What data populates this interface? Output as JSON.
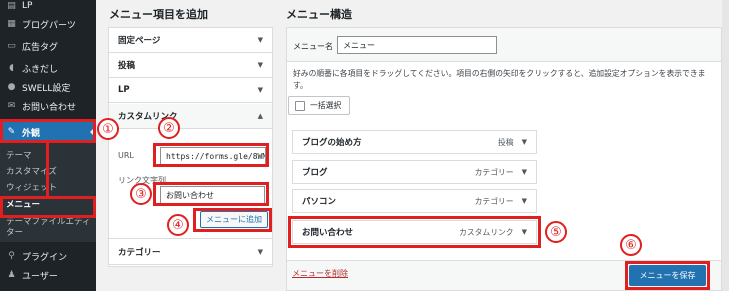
{
  "sidebar": {
    "items": [
      {
        "label": "LP",
        "icon": "page-icon"
      },
      {
        "label": "ブログパーツ",
        "icon": "parts-icon"
      },
      {
        "label": "広告タグ",
        "icon": "ad-icon"
      },
      {
        "label": "ふきだし",
        "icon": "balloon-icon"
      },
      {
        "label": "SWELL設定",
        "icon": "settings-icon"
      },
      {
        "label": "お問い合わせ",
        "icon": "mail-icon"
      },
      {
        "label": "外観",
        "icon": "brush-icon"
      }
    ],
    "submenu": [
      "テーマ",
      "カスタマイズ",
      "ウィジェット",
      "メニュー",
      "テーマファイルエディ",
      "ター"
    ],
    "bottom_items": [
      {
        "label": "プラグイン",
        "icon": "plugin-icon"
      },
      {
        "label": "ユーザー",
        "icon": "user-icon"
      }
    ]
  },
  "add_panel": {
    "title": "メニュー項目を追加",
    "sections": [
      "固定ページ",
      "投稿",
      "LP",
      "カスタムリンク",
      "カテゴリー"
    ],
    "url_label": "URL",
    "url_value": "https://forms.gle/8WM",
    "link_text_label": "リンク文字列",
    "link_text_value": "お問い合わせ",
    "add_button": "メニューに追加"
  },
  "structure": {
    "title": "メニュー構造",
    "menu_name_label": "メニュー名",
    "menu_name_value": "メニュー",
    "instructions": "好みの順番に各項目をドラッグしてください。項目の右側の矢印をクリックすると、追加設定オプションを表示できます。",
    "bulk_select": "一括選択",
    "items": [
      {
        "name": "ブログの始め方",
        "type": "投稿"
      },
      {
        "name": "ブログ",
        "type": "カテゴリー"
      },
      {
        "name": "パソコン",
        "type": "カテゴリー"
      },
      {
        "name": "お問い合わせ",
        "type": "カスタムリンク"
      }
    ],
    "delete_link": "メニューを削除",
    "save_button": "メニューを保存"
  },
  "annotations": [
    "①",
    "②",
    "③",
    "④",
    "⑤",
    "⑥"
  ],
  "colors": {
    "annotation": "#e02020",
    "accent": "#2271b1",
    "sidebar": "#1d2327"
  }
}
